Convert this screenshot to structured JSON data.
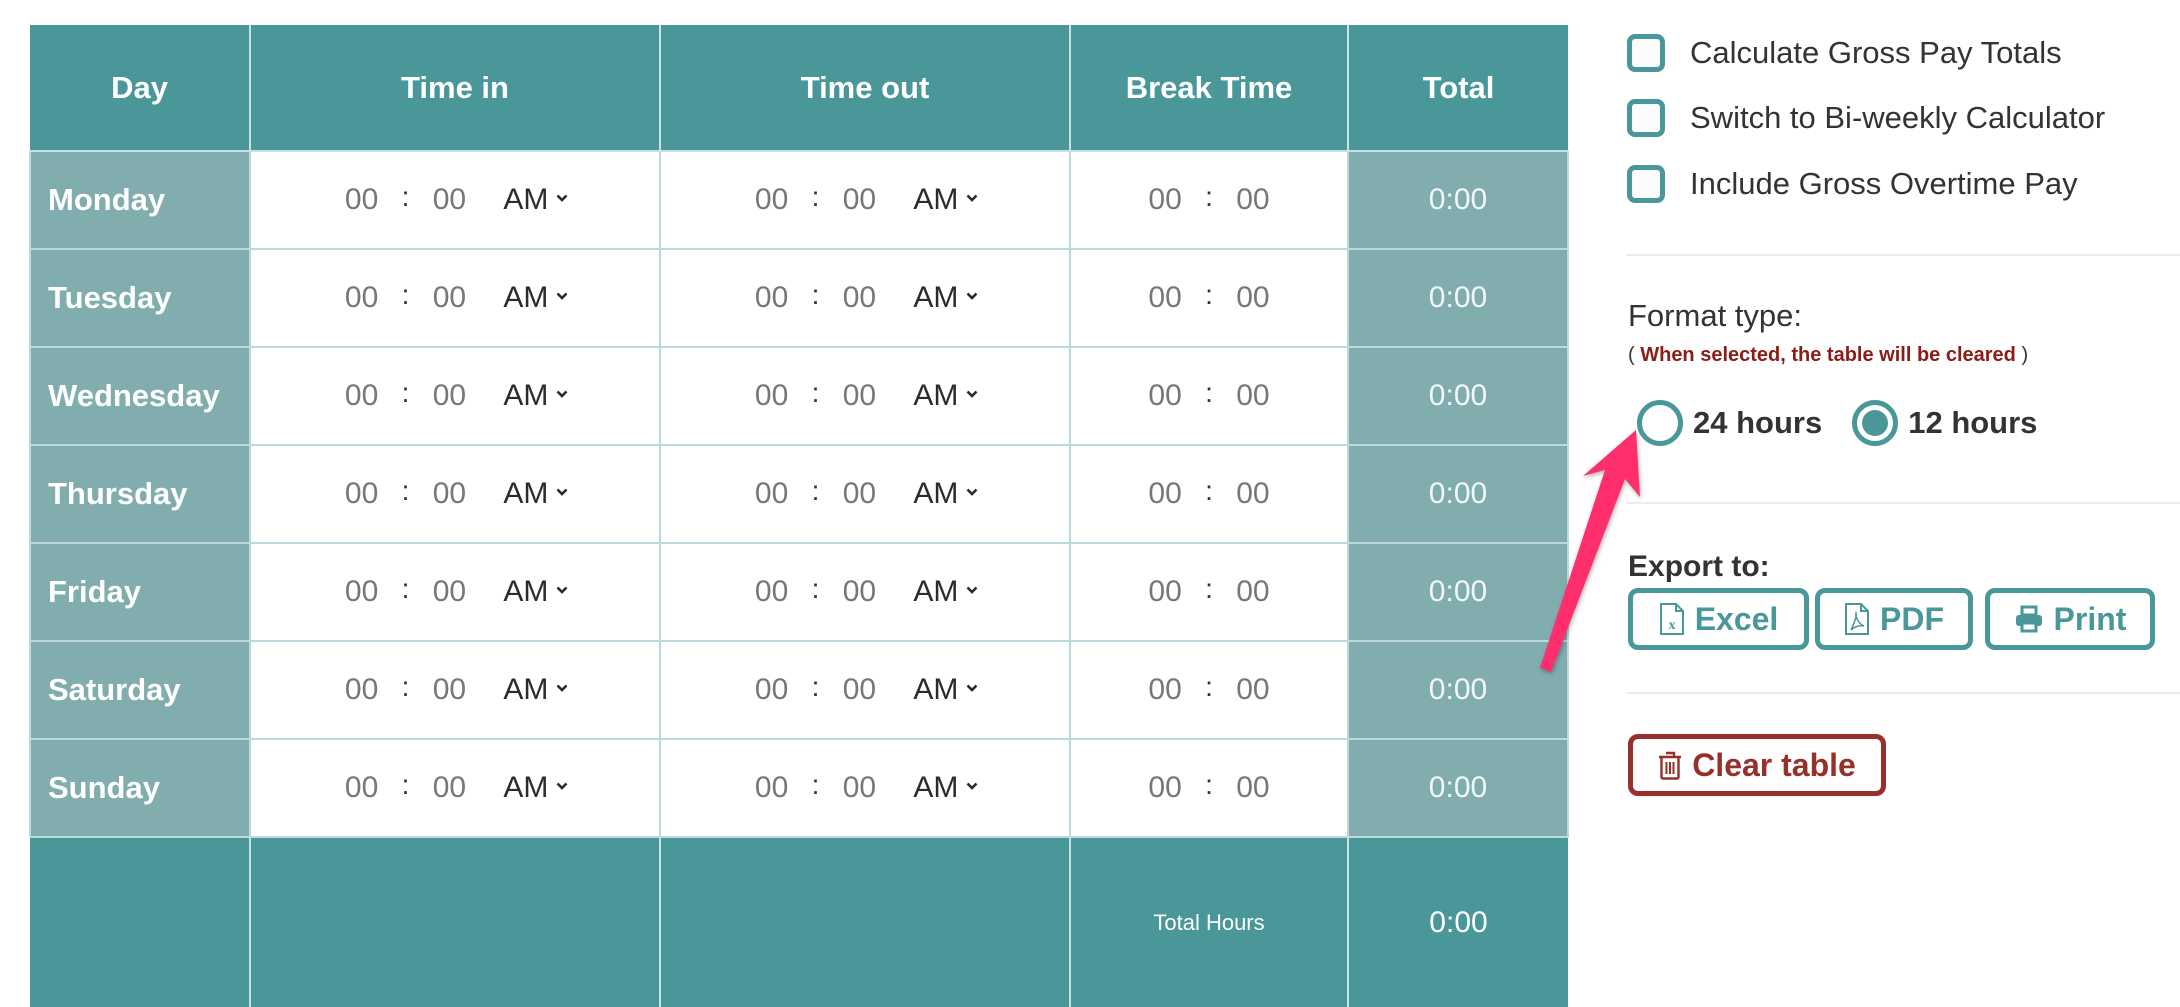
{
  "table": {
    "headers": [
      "Day",
      "Time in",
      "Time out",
      "Break Time",
      "Total"
    ],
    "rows": [
      {
        "day": "Monday",
        "time_in": {
          "hh": "00",
          "mm": "00",
          "ampm": "AM"
        },
        "time_out": {
          "hh": "00",
          "mm": "00",
          "ampm": "AM"
        },
        "break": {
          "hh": "00",
          "mm": "00"
        },
        "total": "0:00"
      },
      {
        "day": "Tuesday",
        "time_in": {
          "hh": "00",
          "mm": "00",
          "ampm": "AM"
        },
        "time_out": {
          "hh": "00",
          "mm": "00",
          "ampm": "AM"
        },
        "break": {
          "hh": "00",
          "mm": "00"
        },
        "total": "0:00"
      },
      {
        "day": "Wednesday",
        "time_in": {
          "hh": "00",
          "mm": "00",
          "ampm": "AM"
        },
        "time_out": {
          "hh": "00",
          "mm": "00",
          "ampm": "AM"
        },
        "break": {
          "hh": "00",
          "mm": "00"
        },
        "total": "0:00"
      },
      {
        "day": "Thursday",
        "time_in": {
          "hh": "00",
          "mm": "00",
          "ampm": "AM"
        },
        "time_out": {
          "hh": "00",
          "mm": "00",
          "ampm": "AM"
        },
        "break": {
          "hh": "00",
          "mm": "00"
        },
        "total": "0:00"
      },
      {
        "day": "Friday",
        "time_in": {
          "hh": "00",
          "mm": "00",
          "ampm": "AM"
        },
        "time_out": {
          "hh": "00",
          "mm": "00",
          "ampm": "AM"
        },
        "break": {
          "hh": "00",
          "mm": "00"
        },
        "total": "0:00"
      },
      {
        "day": "Saturday",
        "time_in": {
          "hh": "00",
          "mm": "00",
          "ampm": "AM"
        },
        "time_out": {
          "hh": "00",
          "mm": "00",
          "ampm": "AM"
        },
        "break": {
          "hh": "00",
          "mm": "00"
        },
        "total": "0:00"
      },
      {
        "day": "Sunday",
        "time_in": {
          "hh": "00",
          "mm": "00",
          "ampm": "AM"
        },
        "time_out": {
          "hh": "00",
          "mm": "00",
          "ampm": "AM"
        },
        "break": {
          "hh": "00",
          "mm": "00"
        },
        "total": "0:00"
      }
    ],
    "separator": ":",
    "footer": {
      "label": "Total Hours",
      "total": "0:00"
    }
  },
  "options": {
    "checkboxes": [
      {
        "label": "Calculate Gross Pay Totals",
        "checked": false
      },
      {
        "label": "Switch to Bi-weekly Calculator",
        "checked": false
      },
      {
        "label": "Include Gross Overtime Pay",
        "checked": false
      }
    ],
    "format": {
      "title": "Format type:",
      "note_open": "( ",
      "note": "When selected, the table will be cleared",
      "note_close": " )",
      "choices": [
        {
          "label": "24 hours",
          "selected": false
        },
        {
          "label": "12 hours",
          "selected": true
        }
      ]
    },
    "export": {
      "title": "Export to:",
      "buttons": [
        {
          "label": "Excel",
          "icon": "file-excel-icon"
        },
        {
          "label": "PDF",
          "icon": "file-pdf-icon"
        },
        {
          "label": "Print",
          "icon": "printer-icon"
        }
      ]
    },
    "clear": {
      "label": "Clear table",
      "icon": "trash-icon"
    }
  },
  "colors": {
    "accent": "#4a979a",
    "accent_light": "#81adaf",
    "danger": "#97302b",
    "annotation_arrow": "#ff2d6c"
  }
}
